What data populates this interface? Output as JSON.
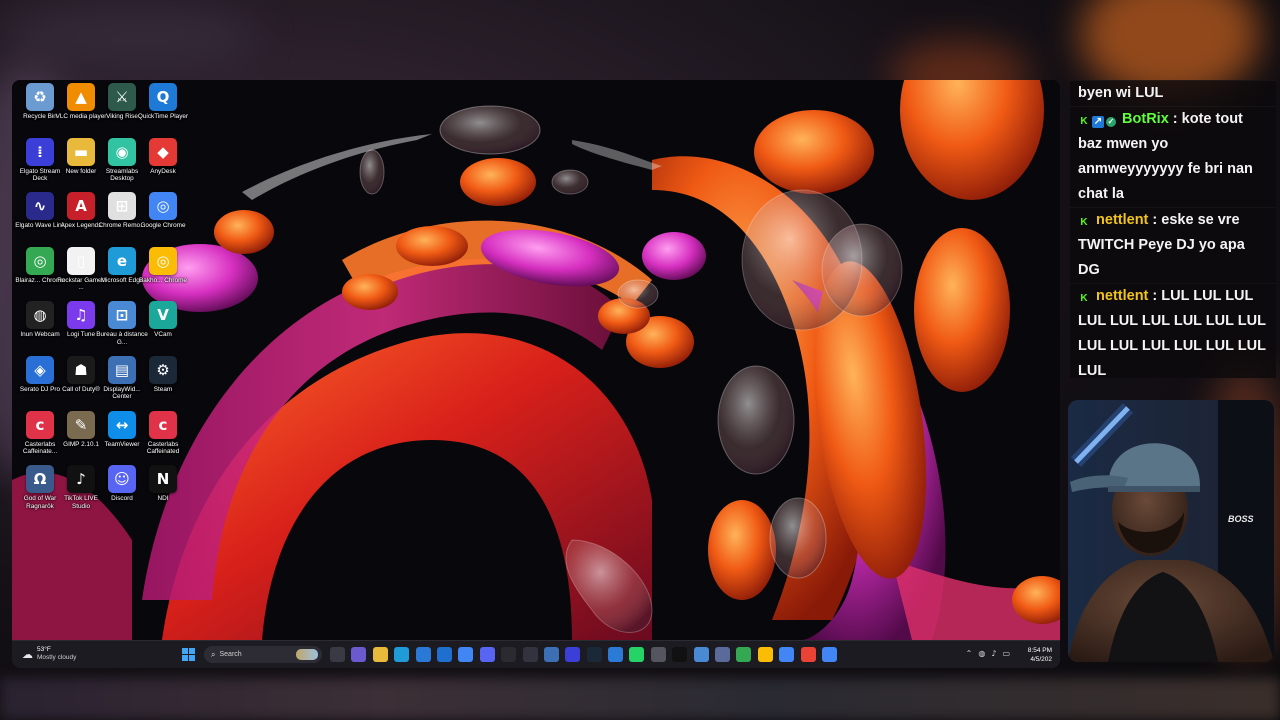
{
  "desktop": {
    "icons": [
      {
        "label": "Recycle Bin",
        "icon": "recycle-bin-icon",
        "color": "#6c9bd1"
      },
      {
        "label": "VLC media player",
        "icon": "vlc-icon",
        "color": "#f08c00"
      },
      {
        "label": "Viking Rise",
        "icon": "viking-rise-icon",
        "color": "#2d5a4a"
      },
      {
        "label": "QuickTime Player",
        "icon": "quicktime-icon",
        "color": "#1e7ad6"
      },
      {
        "label": "Elgato Stream Deck",
        "icon": "stream-deck-icon",
        "color": "#3b3fd8"
      },
      {
        "label": "New folder",
        "icon": "folder-icon",
        "color": "#e8b93a"
      },
      {
        "label": "Streamlabs Desktop",
        "icon": "streamlabs-icon",
        "color": "#31c3a2"
      },
      {
        "label": "AnyDesk",
        "icon": "anydesk-icon",
        "color": "#e53935"
      },
      {
        "label": "Elgato Wave Link",
        "icon": "wave-link-icon",
        "color": "#2a2a8c"
      },
      {
        "label": "Apex Legends",
        "icon": "apex-icon",
        "color": "#c8202a"
      },
      {
        "label": "Chrome Remo...",
        "icon": "chrome-remote-icon",
        "color": "#e0e0e0"
      },
      {
        "label": "Google Chrome",
        "icon": "chrome-icon",
        "color": "#4285f4"
      },
      {
        "label": "Blairaz... Chrome",
        "icon": "chrome-icon",
        "color": "#34a853"
      },
      {
        "label": "Rockstar Games ...",
        "icon": "file-icon",
        "color": "#f2f2f2"
      },
      {
        "label": "Microsoft Edge",
        "icon": "edge-icon",
        "color": "#1f9bd7"
      },
      {
        "label": "Bakho... Chrome",
        "icon": "chrome-icon",
        "color": "#fbbc05"
      },
      {
        "label": "Inun Webcam",
        "icon": "webcam-icon",
        "color": "#222222"
      },
      {
        "label": "Logi Tune",
        "icon": "logi-tune-icon",
        "color": "#7c3aed"
      },
      {
        "label": "Bureau à distance G...",
        "icon": "remote-desktop-icon",
        "color": "#4a8ad4"
      },
      {
        "label": "VCam",
        "icon": "vcam-icon",
        "color": "#1ba89a"
      },
      {
        "label": "Serato DJ Pro",
        "icon": "serato-icon",
        "color": "#2a6fd6"
      },
      {
        "label": "Call of Duty®",
        "icon": "call-of-duty-icon",
        "color": "#1a1a1a"
      },
      {
        "label": "DisplayWid... Center",
        "icon": "display-widget-icon",
        "color": "#3c6fb4"
      },
      {
        "label": "Steam",
        "icon": "steam-icon",
        "color": "#1b2838"
      },
      {
        "label": "Casterlabs Caffeinate...",
        "icon": "casterlabs-icon",
        "color": "#e0334a"
      },
      {
        "label": "GIMP 2.10.1",
        "icon": "gimp-icon",
        "color": "#7a6a50"
      },
      {
        "label": "TeamViewer",
        "icon": "teamviewer-icon",
        "color": "#0e8ee9"
      },
      {
        "label": "Casterlabs Caffeinated",
        "icon": "casterlabs-icon",
        "color": "#e0334a"
      },
      {
        "label": "God of War Ragnarök",
        "icon": "god-of-war-icon",
        "color": "#3a5a8c"
      },
      {
        "label": "TikTok LIVE Studio",
        "icon": "tiktok-icon",
        "color": "#111111"
      },
      {
        "label": "Discord",
        "icon": "discord-icon",
        "color": "#5865f2"
      },
      {
        "label": "NDI",
        "icon": "ndi-icon",
        "color": "#111111"
      }
    ]
  },
  "taskbar": {
    "weather_temp": "53°F",
    "weather_desc": "Mostly cloudy",
    "search_placeholder": "Search",
    "apps": [
      {
        "icon": "task-view-icon",
        "color": "#3a3a44"
      },
      {
        "icon": "widgets-icon",
        "color": "#6a5acd"
      },
      {
        "icon": "file-explorer-icon",
        "color": "#e8b93a"
      },
      {
        "icon": "edge-icon",
        "color": "#1f9bd7"
      },
      {
        "icon": "store-icon",
        "color": "#2b79d6"
      },
      {
        "icon": "mail-icon",
        "color": "#1e6fd0"
      },
      {
        "icon": "chrome-icon",
        "color": "#4285f4"
      },
      {
        "icon": "discord-icon",
        "color": "#5865f2"
      },
      {
        "icon": "obs-icon",
        "color": "#2a2a30"
      },
      {
        "icon": "arrow-icon",
        "color": "#333340"
      },
      {
        "icon": "display-icon",
        "color": "#3c6fb4"
      },
      {
        "icon": "stream-deck-icon",
        "color": "#3b3fd8"
      },
      {
        "icon": "steam-icon",
        "color": "#1b2838"
      },
      {
        "icon": "monitor-icon",
        "color": "#2a7ad6"
      },
      {
        "icon": "whatsapp-icon",
        "color": "#25d366"
      },
      {
        "icon": "printer-icon",
        "color": "#555560"
      },
      {
        "icon": "tiktok-icon",
        "color": "#111111"
      },
      {
        "icon": "remote-desktop-icon",
        "color": "#4a8ad4"
      },
      {
        "icon": "vpn-icon",
        "color": "#5a6a9a"
      },
      {
        "icon": "chrome-icon",
        "color": "#34a853"
      },
      {
        "icon": "chrome-icon",
        "color": "#fbbc05"
      },
      {
        "icon": "chrome-icon",
        "color": "#4285f4"
      },
      {
        "icon": "chrome-icon",
        "color": "#ea4335"
      },
      {
        "icon": "chrome-icon",
        "color": "#4285f4"
      }
    ],
    "tray_icons": [
      "chevron-up-icon",
      "network-icon",
      "speaker-icon",
      "battery-icon"
    ],
    "clock_time": "8:54 PM",
    "clock_date": "4/5/202"
  },
  "chat": {
    "messages": [
      {
        "user": "",
        "badges": [],
        "text": "byen wi LUL"
      },
      {
        "user": "BotRix",
        "user_color": "green",
        "badges": [
          "k-badge",
          "prime-badge",
          "verified-badge"
        ],
        "text": "kote tout baz mwen yo anmweyyyyyyy fe bri nan chat la"
      },
      {
        "user": "nettlent",
        "user_color": "gold",
        "badges": [
          "k-badge"
        ],
        "text": "eske se vre TWITCH Peye DJ yo apa DG"
      },
      {
        "user": "nettlent",
        "user_color": "gold",
        "badges": [
          "k-badge"
        ],
        "text": "LUL LUL LUL LUL LUL LUL LUL LUL LUL LUL LUL LUL LUL LUL LUL LUL"
      }
    ]
  },
  "webcam": {
    "shirt_text": "BOSS"
  }
}
